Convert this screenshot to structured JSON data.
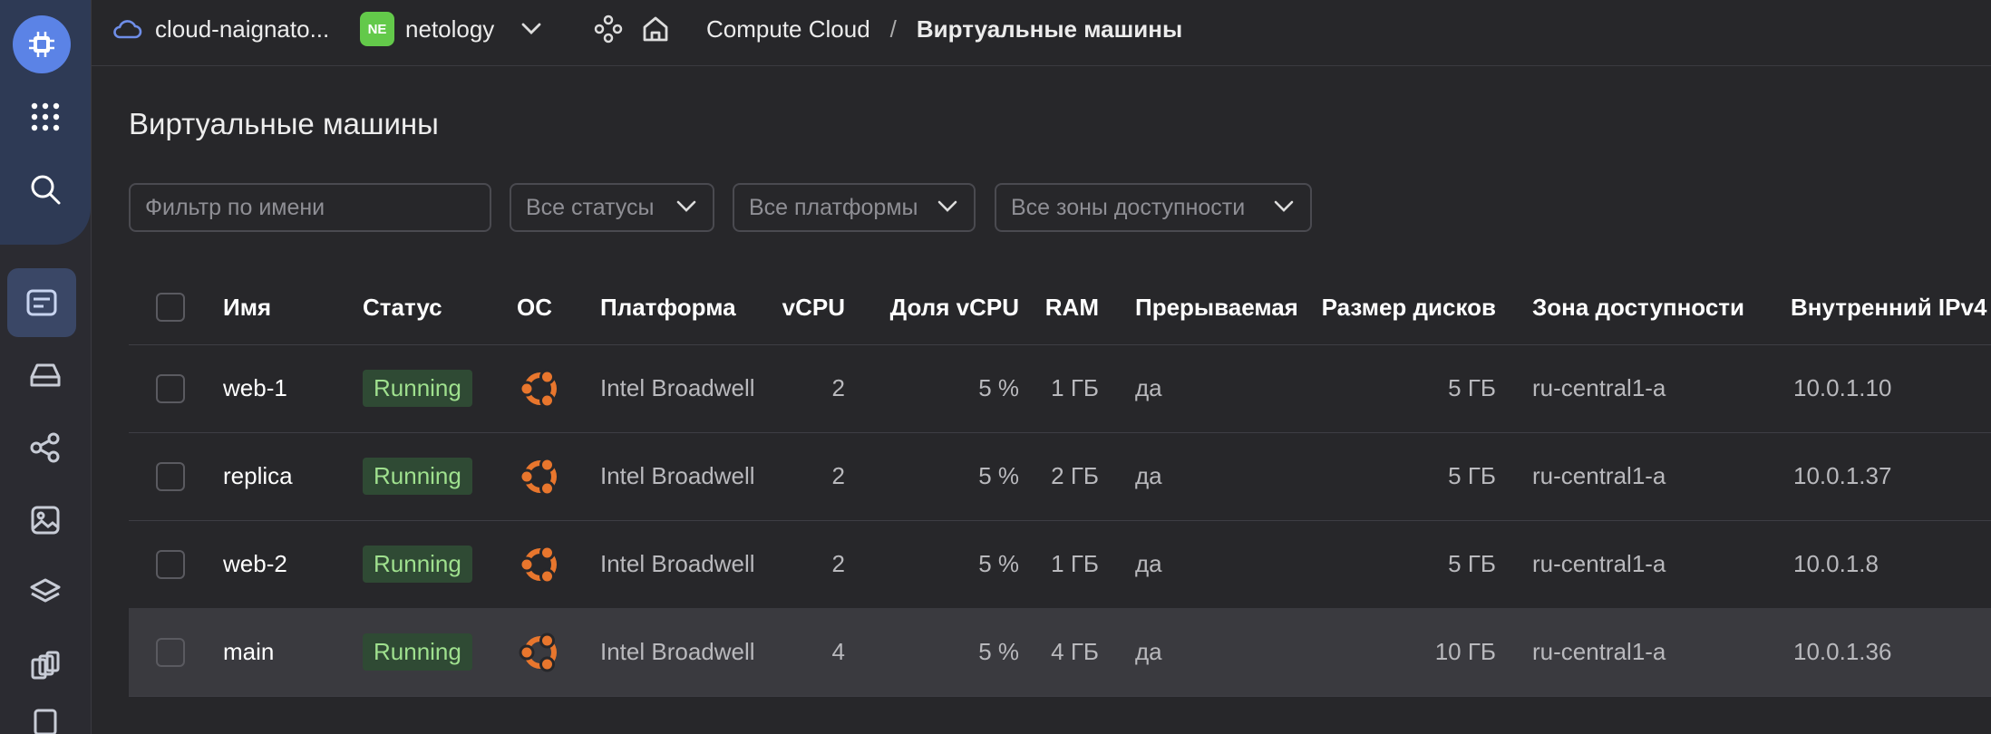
{
  "colors": {
    "accent": "#5b83e6",
    "status_running_bg": "#2f4a34",
    "status_running_text": "#9fe08e",
    "os_icon": "#e8762d",
    "org_badge": "#63c94a"
  },
  "rail": {
    "items": [
      {
        "name": "compute-icon"
      },
      {
        "name": "apps-grid-icon"
      },
      {
        "name": "search-icon"
      },
      {
        "name": "vm-list-icon"
      },
      {
        "name": "disk-icon"
      },
      {
        "name": "network-icon"
      },
      {
        "name": "image-icon"
      },
      {
        "name": "layers-icon"
      },
      {
        "name": "snapshots-icon"
      }
    ]
  },
  "topbar": {
    "cloud_name": "cloud-naignato...",
    "org_badge": "NE",
    "org_name": "netology",
    "breadcrumb": {
      "service": "Compute Cloud",
      "separator": "/",
      "current": "Виртуальные машины"
    }
  },
  "page": {
    "title": "Виртуальные машины"
  },
  "filters": {
    "name_placeholder": "Фильтр по имени",
    "status": "Все статусы",
    "platform": "Все платформы",
    "zone": "Все зоны доступности"
  },
  "table": {
    "columns": [
      "Имя",
      "Статус",
      "ОС",
      "Платформа",
      "vCPU",
      "Доля vCPU",
      "RAM",
      "Прерываемая",
      "Размер дисков",
      "Зона доступности",
      "Внутренний IPv4"
    ],
    "rows": [
      {
        "name": "web-1",
        "status": "Running",
        "os": "ubuntu-icon",
        "platform": "Intel Broadwell",
        "vcpu": "2",
        "vcpu_share": "5 %",
        "ram": "1 ГБ",
        "preemptible": "да",
        "disk": "5 ГБ",
        "zone": "ru-central1-a",
        "ipv4": "10.0.1.10"
      },
      {
        "name": "replica",
        "status": "Running",
        "os": "ubuntu-icon",
        "platform": "Intel Broadwell",
        "vcpu": "2",
        "vcpu_share": "5 %",
        "ram": "2 ГБ",
        "preemptible": "да",
        "disk": "5 ГБ",
        "zone": "ru-central1-a",
        "ipv4": "10.0.1.37"
      },
      {
        "name": "web-2",
        "status": "Running",
        "os": "ubuntu-icon",
        "platform": "Intel Broadwell",
        "vcpu": "2",
        "vcpu_share": "5 %",
        "ram": "1 ГБ",
        "preemptible": "да",
        "disk": "5 ГБ",
        "zone": "ru-central1-a",
        "ipv4": "10.0.1.8"
      },
      {
        "name": "main",
        "status": "Running",
        "os": "ubuntu-icon",
        "platform": "Intel Broadwell",
        "vcpu": "4",
        "vcpu_share": "5 %",
        "ram": "4 ГБ",
        "preemptible": "да",
        "disk": "10 ГБ",
        "zone": "ru-central1-a",
        "ipv4": "10.0.1.36"
      }
    ]
  }
}
